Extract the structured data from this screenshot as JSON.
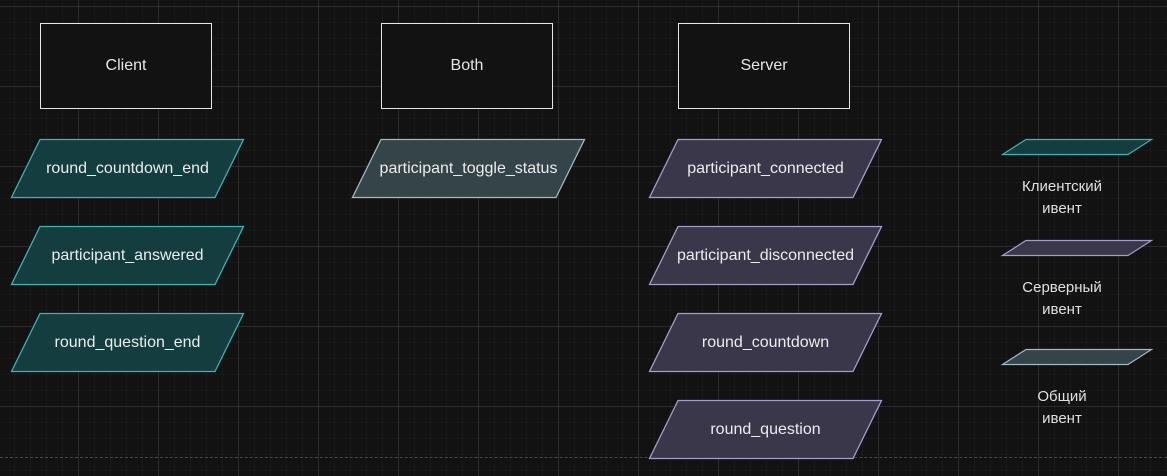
{
  "colors": {
    "client_fill": "#133d3e",
    "client_stroke": "#3fb1b0",
    "both_fill": "#344448",
    "both_stroke": "#9eb8c4",
    "server_fill": "#3a374a",
    "server_stroke": "#a69ccc",
    "header_stroke": "#e6e6e6"
  },
  "headers": {
    "client": "Client",
    "both": "Both",
    "server": "Server"
  },
  "events": {
    "client": [
      "round_countdown_end",
      "participant_answered",
      "round_question_end"
    ],
    "both": [
      "participant_toggle_status"
    ],
    "server": [
      "participant_connected",
      "participant_disconnected",
      "round_countdown",
      "round_question"
    ]
  },
  "legend": {
    "client": "Клиентский\nивент",
    "server": "Серверный\nивент",
    "both": "Общий\nивент"
  }
}
